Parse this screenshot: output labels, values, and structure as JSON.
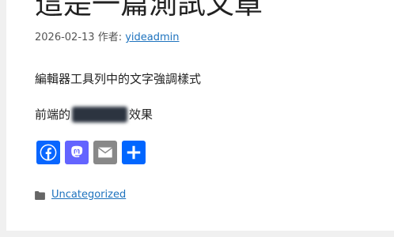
{
  "post": {
    "title": "這是一篇測試文章",
    "date": "2026-02-13",
    "author_prefix": "作者:",
    "author": "yideadmin",
    "paragraph1": "編輯器工具列中的文字強調樣式",
    "paragraph2_before": "前端的",
    "paragraph2_after": "效果"
  },
  "share": {
    "buttons": [
      {
        "name": "facebook",
        "icon": "facebook-icon",
        "color": "#0866ff"
      },
      {
        "name": "mastodon",
        "icon": "mastodon-icon",
        "color": "#6364ff"
      },
      {
        "name": "email",
        "icon": "email-icon",
        "color": "#888888"
      },
      {
        "name": "share",
        "icon": "share-plus-icon",
        "color": "#0166ff"
      }
    ]
  },
  "footer": {
    "category_icon": "folder-icon",
    "category": "Uncategorized"
  },
  "colors": {
    "link": "#1e73be",
    "background": "#f0f0f0",
    "card": "#ffffff"
  }
}
